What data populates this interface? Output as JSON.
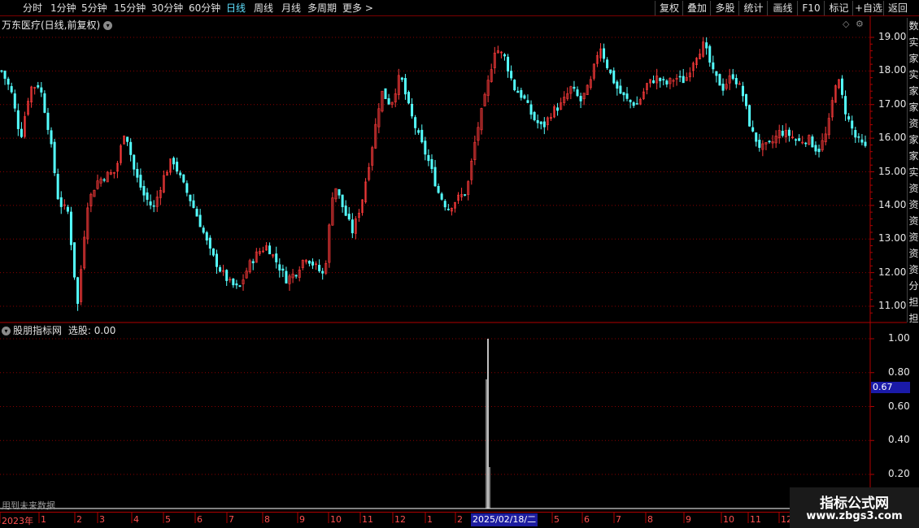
{
  "toolbar": {
    "periods": [
      {
        "label": "分时"
      },
      {
        "label": "1分钟"
      },
      {
        "label": "5分钟"
      },
      {
        "label": "15分钟"
      },
      {
        "label": "30分钟"
      },
      {
        "label": "60分钟"
      },
      {
        "label": "日线",
        "active": true
      },
      {
        "label": "周线"
      },
      {
        "label": "月线"
      },
      {
        "label": "多周期"
      },
      {
        "label": "更多 >"
      }
    ],
    "actions": [
      {
        "label": "复权"
      },
      {
        "label": "叠加"
      },
      {
        "label": "多股"
      },
      {
        "label": "统计"
      },
      {
        "label": "画线"
      },
      {
        "label": "F10"
      },
      {
        "label": "标记"
      },
      {
        "label": "+自选"
      },
      {
        "label": "返回"
      }
    ]
  },
  "main_chart": {
    "title": "万东医疗(日线,前复权)",
    "price_ticks": [
      "19.00",
      "18.00",
      "17.00",
      "16.00",
      "15.00",
      "14.00",
      "13.00",
      "12.00",
      "11.00"
    ],
    "colors": {
      "up": "#ff3b3b",
      "down": "#54ffff",
      "grid": "#8a0000"
    }
  },
  "indicator": {
    "name": "股朋指标网",
    "value_text": "选股: 0.00",
    "ticks": [
      "1.00",
      "0.80",
      "0.60",
      "0.40",
      "0.20"
    ],
    "current_tag": "0.67",
    "warning": "用到未来数据"
  },
  "time_axis": {
    "labels": [
      "2023年",
      "1",
      "2",
      "3",
      "4",
      "5",
      "6",
      "7",
      "8",
      "9",
      "10",
      "11",
      "12",
      "1",
      "2",
      "5",
      "6",
      "7",
      "8",
      "9",
      "10",
      "11",
      "12"
    ],
    "current": "2025/02/18/二"
  },
  "right_strip": {
    "chars": [
      "数",
      "实",
      "家",
      "实",
      "家",
      "家",
      "资",
      "家",
      "家",
      "实",
      "资",
      "资",
      "资",
      "资",
      "资",
      "资",
      "分",
      "担",
      "担"
    ]
  },
  "watermark": {
    "line1": "指标公式网",
    "line2": "www.zbgs3.com"
  },
  "chart_data": {
    "type": "candlestick",
    "title": "万东医疗(日线,前复权)",
    "ylim": [
      10.6,
      19.3
    ],
    "close_path": [
      18.0,
      17.4,
      16.0,
      17.5,
      17.6,
      16.2,
      14.1,
      13.8,
      11.0,
      14.0,
      14.7,
      14.9,
      15.0,
      16.3,
      15.0,
      14.3,
      13.9,
      14.8,
      15.4,
      14.7,
      14.1,
      13.4,
      12.6,
      12.1,
      11.7,
      11.5,
      12.2,
      12.6,
      12.8,
      12.3,
      11.8,
      12.0,
      12.5,
      12.2,
      11.9,
      14.7,
      13.9,
      13.2,
      14.2,
      15.7,
      17.4,
      17.0,
      17.9,
      16.8,
      16.0,
      15.3,
      14.4,
      13.9,
      14.2,
      14.4,
      16.1,
      17.3,
      18.7,
      18.4,
      17.5,
      17.2,
      16.6,
      16.3,
      16.8,
      17.0,
      17.5,
      17.1,
      17.6,
      18.8,
      18.0,
      17.4,
      17.1,
      17.0,
      17.6,
      17.8,
      17.6,
      17.8,
      17.7,
      18.4,
      18.8,
      17.9,
      17.5,
      17.9,
      17.4,
      16.2,
      15.7,
      15.8,
      16.2,
      16.1,
      15.9,
      16.0,
      15.6,
      16.2,
      17.9,
      16.7,
      16.0,
      15.7
    ],
    "indicator_signal": {
      "date": "2025/02/18/二",
      "value": 1.0
    }
  }
}
